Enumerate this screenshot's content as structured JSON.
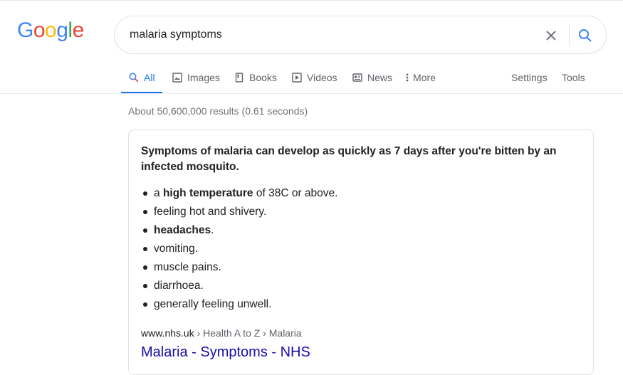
{
  "logo": {
    "letters": [
      "G",
      "o",
      "o",
      "g",
      "l",
      "e"
    ],
    "colors": [
      "#4285F4",
      "#EA4335",
      "#FBBC05",
      "#4285F4",
      "#34A853",
      "#EA4335"
    ]
  },
  "search": {
    "query": "malaria symptoms",
    "clear_icon": "close-icon",
    "submit_icon": "search-icon"
  },
  "tabs": [
    {
      "label": "All",
      "icon": "search-icon",
      "active": true
    },
    {
      "label": "Images",
      "icon": "image-icon"
    },
    {
      "label": "Books",
      "icon": "book-icon"
    },
    {
      "label": "Videos",
      "icon": "play-icon"
    },
    {
      "label": "News",
      "icon": "news-icon"
    },
    {
      "label": "More",
      "icon": "more-vert-icon"
    }
  ],
  "tools": {
    "settings": "Settings",
    "tools": "Tools"
  },
  "stats": "About 50,600,000 results (0.61 seconds)",
  "snippet": {
    "headline": "Symptoms of malaria can develop as quickly as 7 days after you're bitten by an infected mosquito.",
    "bullets": [
      {
        "prefix": "a ",
        "bold": "high temperature",
        "suffix": " of 38C or above."
      },
      {
        "prefix": "feeling hot and shivery.",
        "bold": "",
        "suffix": ""
      },
      {
        "prefix": "",
        "bold": "headaches",
        "suffix": "."
      },
      {
        "prefix": "vomiting.",
        "bold": "",
        "suffix": ""
      },
      {
        "prefix": "muscle pains.",
        "bold": "",
        "suffix": ""
      },
      {
        "prefix": "diarrhoea.",
        "bold": "",
        "suffix": ""
      },
      {
        "prefix": "generally feeling unwell.",
        "bold": "",
        "suffix": ""
      }
    ],
    "cite_domain": "www.nhs.uk",
    "cite_path": " › Health A to Z › Malaria",
    "link_title": "Malaria - Symptoms - NHS"
  },
  "colors": {
    "accent": "#1a73e8",
    "link": "#1a0dab",
    "muted": "#70757a"
  }
}
